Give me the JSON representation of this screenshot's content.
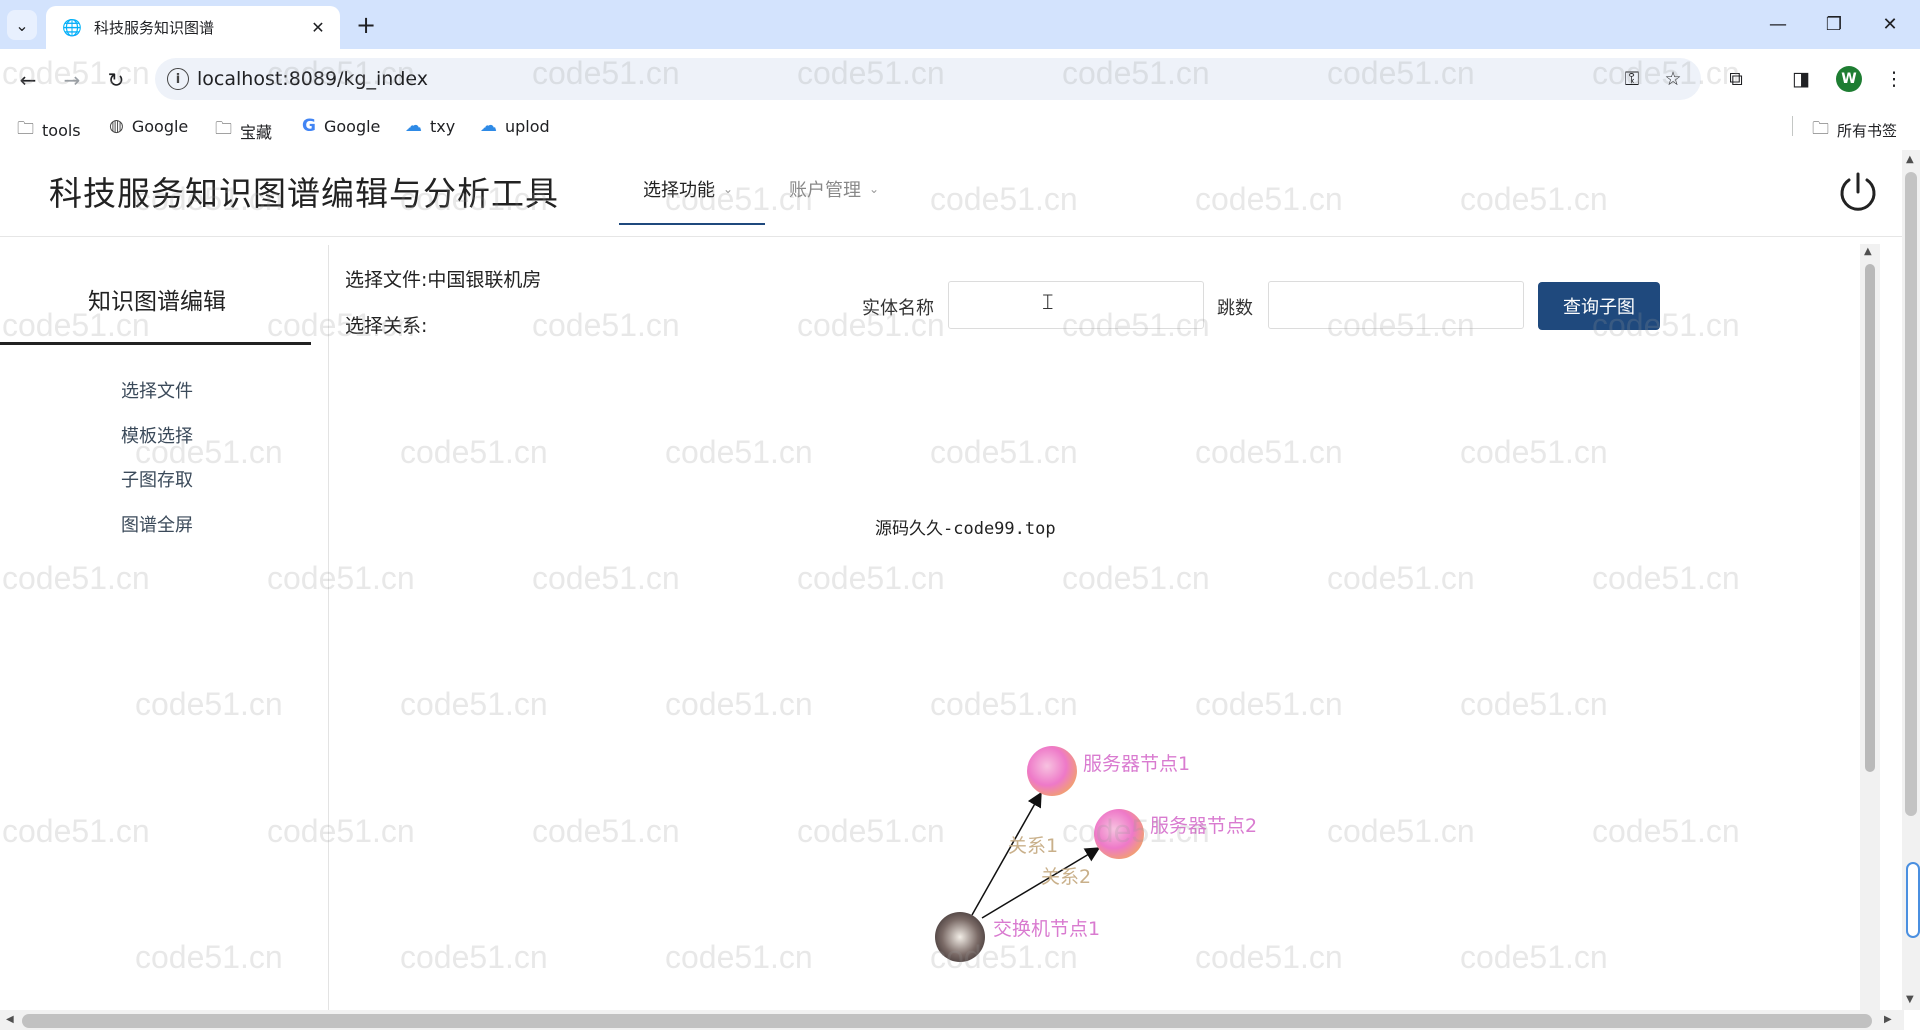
{
  "browser": {
    "tab_title": "科技服务知识图谱",
    "url": "localhost:8089/kg_index",
    "avatar_letter": "W",
    "bookmarks": [
      {
        "label": "tools",
        "icon": "folder-icon"
      },
      {
        "label": "Google",
        "icon": "globe-icon"
      },
      {
        "label": "宝藏",
        "icon": "folder-icon"
      },
      {
        "label": "Google",
        "icon": "google-icon"
      },
      {
        "label": "txy",
        "icon": "cloud-icon"
      },
      {
        "label": "uplod",
        "icon": "cloud-icon"
      }
    ],
    "all_bookmarks": "所有书签"
  },
  "app": {
    "title": "科技服务知识图谱编辑与分析工具",
    "menu": [
      "选择功能",
      "账户管理"
    ],
    "accent": "#1f497d"
  },
  "sidebar": {
    "title": "知识图谱编辑",
    "items": [
      "选择文件",
      "模板选择",
      "子图存取",
      "图谱全屏"
    ]
  },
  "main": {
    "file_label": "选择文件:中国银联机房",
    "relation_label": "选择关系:",
    "entity_label": "实体名称",
    "entity_value": "",
    "hops_label": "跳数",
    "hops_value": "",
    "query_button": "查询子图",
    "center_note": "源码久久-code99.top"
  },
  "graph": {
    "nodes": [
      {
        "label": "服务器节点1",
        "color": "#e86bc3"
      },
      {
        "label": "服务器节点2",
        "color": "#e86bc3"
      },
      {
        "label": "交换机节点1",
        "color": "#5a4a4a"
      }
    ],
    "edges": [
      {
        "label": "关系1",
        "from": "交换机节点1",
        "to": "服务器节点1"
      },
      {
        "label": "关系2",
        "from": "交换机节点1",
        "to": "服务器节点2"
      }
    ],
    "node_label_color": "#d97bd0",
    "edge_label_color": "#c9b08a"
  },
  "watermark": "code51.cn"
}
